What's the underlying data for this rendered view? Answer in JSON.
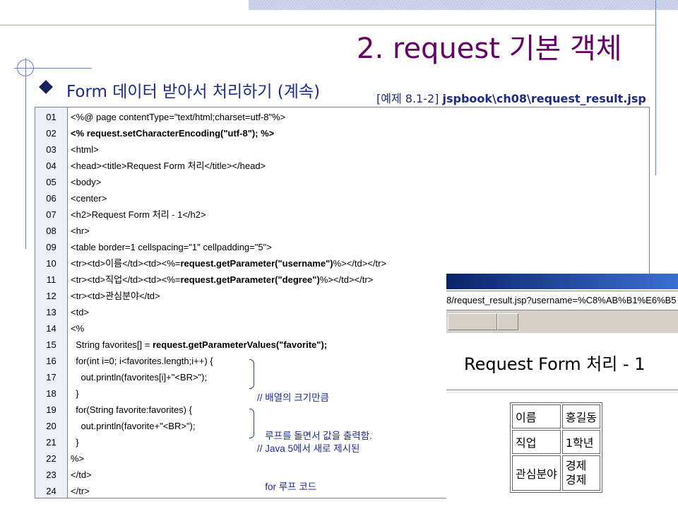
{
  "title": "2. request 기본 객체",
  "subtitle": "Form 데이터 받아서 처리하기 (계속)",
  "example_prefix": "[예제 8.1-2]",
  "example_path": "jspbook\\ch08\\request_result.jsp",
  "code_lines": [
    {
      "num": "01",
      "text": "<%@ page contentType=\"text/html;charset=utf-8\"%>"
    },
    {
      "num": "02",
      "text": "<% request.setCharacterEncoding(\"utf-8\"); %>"
    },
    {
      "num": "03",
      "text": "<html>"
    },
    {
      "num": "04",
      "text": "<head><title>Request Form 처리</title></head>"
    },
    {
      "num": "05",
      "text": "<body>"
    },
    {
      "num": "06",
      "text": "<center>"
    },
    {
      "num": "07",
      "text": "<h2>Request Form 처리 - 1</h2>"
    },
    {
      "num": "08",
      "text": "<hr>"
    },
    {
      "num": "09",
      "text": "<table border=1 cellspacing=\"1\" cellpadding=\"5\">"
    },
    {
      "num": "10",
      "pre": "<tr><td>이름</td><td><%=",
      "bold": "request.getParameter(\"username\")",
      "post": "%></td></tr>"
    },
    {
      "num": "11",
      "pre": "<tr><td>직업</td><td><%=",
      "bold": "request.getParameter(\"degree\")",
      "post": "%></td></tr>"
    },
    {
      "num": "12",
      "text": "<tr><td>관심분야</td>"
    },
    {
      "num": "13",
      "text": "<td>"
    },
    {
      "num": "14",
      "text": "<%"
    },
    {
      "num": "15",
      "pre": "  String favorites[] = ",
      "bold": "request.getParameterValues(\"favorite\");",
      "post": ""
    },
    {
      "num": "16",
      "text": "  for(int i=0; i<favorites.length;i++) {"
    },
    {
      "num": "17",
      "text": "    out.println(favorites[i]+\"<BR>\");"
    },
    {
      "num": "18",
      "text": "  }"
    },
    {
      "num": "19",
      "text": "  for(String favorite:favorites) {"
    },
    {
      "num": "20",
      "text": "    out.println(favorite+\"<BR>\");"
    },
    {
      "num": "21",
      "text": "  }"
    },
    {
      "num": "22",
      "text": "%>"
    },
    {
      "num": "23",
      "text": "</td>"
    },
    {
      "num": "24",
      "text": "</tr>"
    }
  ],
  "comments": [
    {
      "line1": "// 배열의 크기만큼",
      "line2": "   루프를 돌면서 값을 출력함."
    },
    {
      "line1": "// Java 5에서 새로 제시된",
      "line2": "   for 루프 코드"
    }
  ],
  "browser": {
    "url": "8/request_result.jsp?username=%C8%AB%B1%E6%B5",
    "heading": "Request Form 처리 - 1",
    "rows": [
      {
        "label": "이름",
        "value": "홍길동"
      },
      {
        "label": "직업",
        "value": "1학년"
      },
      {
        "label": "관심분야",
        "value": "경제\n경제"
      }
    ]
  },
  "colors": {
    "title": "#660066",
    "subtitle": "#1c2a8a",
    "comment": "#1c2a9a"
  }
}
